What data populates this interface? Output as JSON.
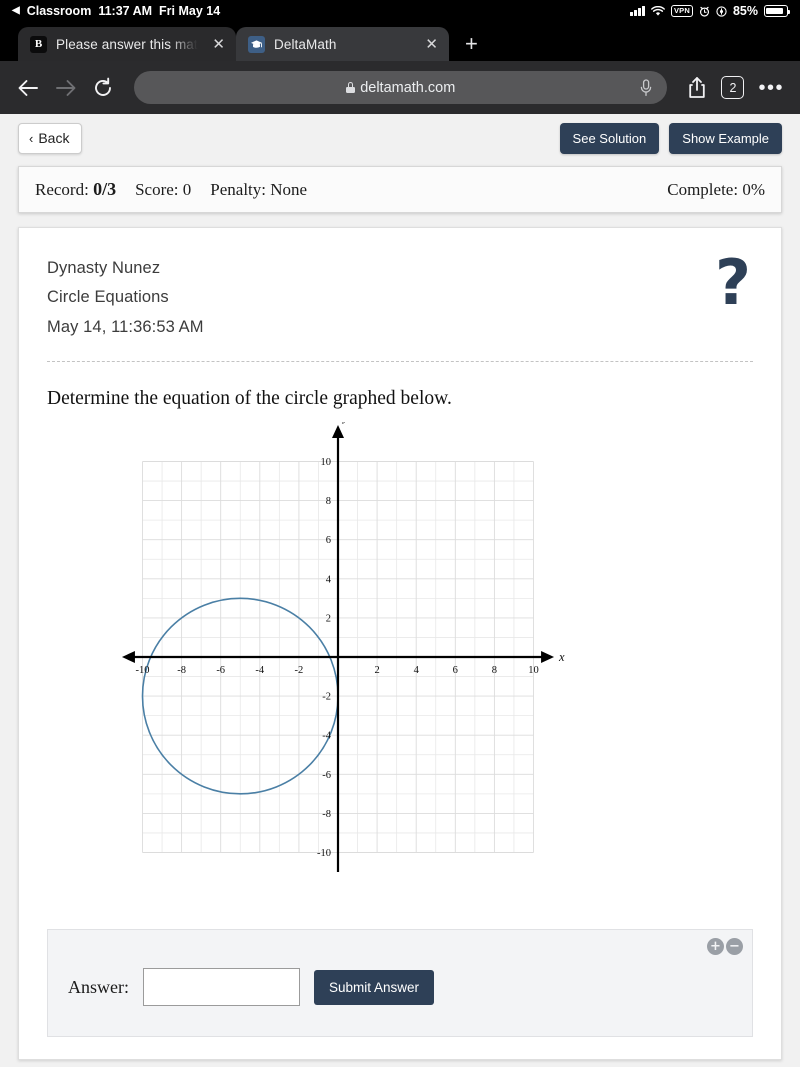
{
  "status_bar": {
    "back_app": "Classroom",
    "back_arrow": "◀",
    "time": "11:37 AM",
    "date": "Fri May 14",
    "vpn_label": "VPN",
    "battery_percent": "85%",
    "icons": [
      "signal-icon",
      "wifi-icon",
      "vpn-icon",
      "alarm-icon",
      "location-icon",
      "battery-icon"
    ]
  },
  "browser": {
    "tabs": [
      {
        "favicon": "brainly-b-icon",
        "favicon_letter": "B",
        "title": "Please answer this math q",
        "active": false,
        "close_label": "✕"
      },
      {
        "favicon": "deltamath-cap-icon",
        "favicon_letter": "",
        "title": "DeltaMath",
        "active": true,
        "close_label": "✕"
      }
    ],
    "new_tab_label": "+",
    "url": "deltamath.com",
    "tab_count": "2",
    "overflow_label": "•••",
    "icons": [
      "back-arrow-icon",
      "forward-arrow-icon",
      "reload-icon",
      "lock-icon",
      "microphone-icon",
      "share-icon",
      "tab-count-icon",
      "more-icon"
    ]
  },
  "header": {
    "back_label": "Back",
    "back_chevron": "‹",
    "see_solution_label": "See Solution",
    "show_example_label": "Show Example"
  },
  "record_bar": {
    "record_label": "Record:",
    "record_value": "0/3",
    "score_label": "Score:",
    "score_value": "0",
    "penalty_label": "Penalty:",
    "penalty_value": "None",
    "complete_label": "Complete:",
    "complete_value": "0%"
  },
  "assignment": {
    "student_name": "Dynasty Nunez",
    "topic": "Circle Equations",
    "timestamp": "May 14, 11:36:53 AM",
    "help_icon": "?",
    "prompt": "Determine the equation of the circle graphed below."
  },
  "chart_data": {
    "type": "scatter",
    "title": "",
    "xlabel": "x",
    "ylabel": "y",
    "xlim": [
      -11,
      11
    ],
    "ylim": [
      -11,
      11
    ],
    "grid": true,
    "grid_xrange": [
      -10,
      10
    ],
    "grid_yrange": [
      -10,
      10
    ],
    "minor_step": 1,
    "major_step": 2,
    "x_ticks": [
      -10,
      -8,
      -6,
      -4,
      -2,
      2,
      4,
      6,
      8,
      10
    ],
    "y_ticks": [
      10,
      8,
      6,
      4,
      2,
      -2,
      -4,
      -6,
      -8,
      -10
    ],
    "x_tick_labels": [
      "-10",
      "-8",
      "-6",
      "-4",
      "-2",
      "2",
      "4",
      "6",
      "8",
      "10"
    ],
    "y_tick_labels": [
      "10",
      "8",
      "6",
      "4",
      "2",
      "-2",
      "-4",
      "-6",
      "-8",
      "-10"
    ],
    "shapes": [
      {
        "kind": "circle",
        "center": [
          -5,
          -2
        ],
        "radius": 5,
        "color": "#4a7fa5",
        "stroke_width": 1.6,
        "fill": "none",
        "x_extent": [
          -10,
          0
        ],
        "y_extent": [
          -7,
          3
        ]
      }
    ],
    "axis_color": "#000000",
    "grid_color": "#e3e3e3"
  },
  "answer_panel": {
    "label": "Answer:",
    "input_value": "",
    "input_placeholder": "",
    "submit_label": "Submit Answer",
    "zoom_in_label": "+",
    "zoom_out_label": "−"
  }
}
